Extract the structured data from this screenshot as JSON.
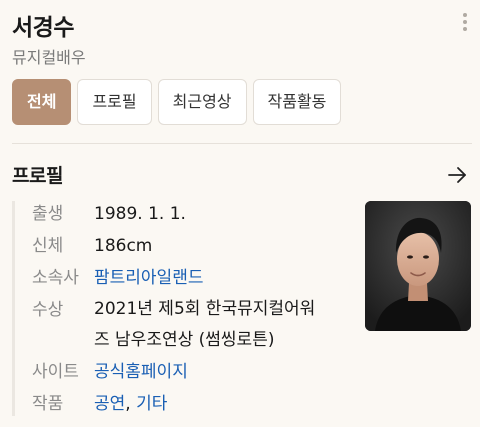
{
  "profile": {
    "name": "서경수",
    "occupation": "뮤지컬배우"
  },
  "tabs": [
    {
      "label": "전체",
      "active": true
    },
    {
      "label": "프로필",
      "active": false
    },
    {
      "label": "최근영상",
      "active": false
    },
    {
      "label": "작품활동",
      "active": false
    }
  ],
  "section": {
    "title": "프로필"
  },
  "info": {
    "birth": {
      "label": "출생",
      "value": "1989. 1. 1."
    },
    "body": {
      "label": "신체",
      "value": "186cm"
    },
    "agency": {
      "label": "소속사",
      "value": "팜트리아일랜드"
    },
    "award": {
      "label": "수상",
      "line1": "2021년 제5회 한국뮤지컬어워",
      "line2": "즈 남우조연상 (썸씽로튼)"
    },
    "site": {
      "label": "사이트",
      "value": "공식홈페이지"
    },
    "works": {
      "label": "작품",
      "item1": "공연",
      "separator": ", ",
      "item2": "기타"
    }
  },
  "icons": {
    "more": "more-vertical-icon",
    "arrow": "arrow-right-icon"
  },
  "colors": {
    "accent": "#b68f74",
    "link": "#1a5fb4",
    "background": "#fbf8f3"
  }
}
